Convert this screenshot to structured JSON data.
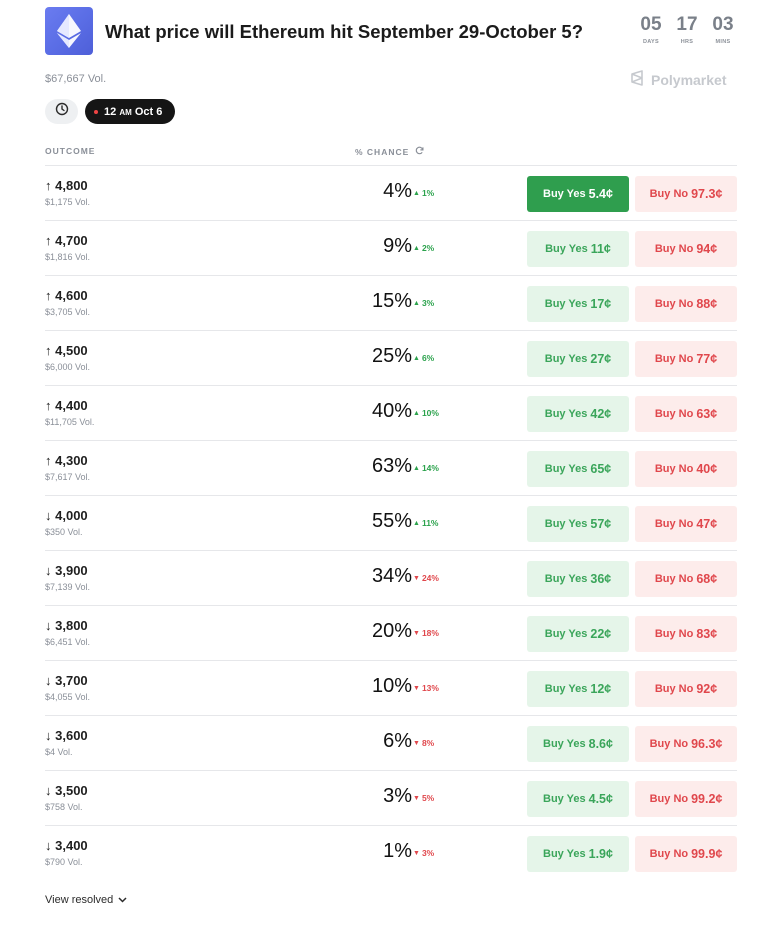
{
  "market": {
    "title": "What price will Ethereum hit September 29-October 5?",
    "volume": "$67,667 Vol.",
    "brand": "Polymarket"
  },
  "countdown": [
    {
      "value": "05",
      "label": "DAYS"
    },
    {
      "value": "17",
      "label": "HRS"
    },
    {
      "value": "03",
      "label": "MINS"
    }
  ],
  "filters": {
    "date_chip_time": "12",
    "date_chip_ampm": "AM",
    "date_chip_date": "Oct 6"
  },
  "columns": {
    "outcome": "OUTCOME",
    "chance": "% CHANCE"
  },
  "rows": [
    {
      "arrow": "↑",
      "label": "4,800",
      "vol": "$1,175 Vol.",
      "chance": "4%",
      "delta": "1%",
      "dir": "up",
      "yes_label": "Buy Yes",
      "yes_price": "5.4¢",
      "no_label": "Buy No",
      "no_price": "97.3¢",
      "selected": true
    },
    {
      "arrow": "↑",
      "label": "4,700",
      "vol": "$1,816 Vol.",
      "chance": "9%",
      "delta": "2%",
      "dir": "up",
      "yes_label": "Buy Yes",
      "yes_price": "11¢",
      "no_label": "Buy No",
      "no_price": "94¢"
    },
    {
      "arrow": "↑",
      "label": "4,600",
      "vol": "$3,705 Vol.",
      "chance": "15%",
      "delta": "3%",
      "dir": "up",
      "yes_label": "Buy Yes",
      "yes_price": "17¢",
      "no_label": "Buy No",
      "no_price": "88¢"
    },
    {
      "arrow": "↑",
      "label": "4,500",
      "vol": "$6,000 Vol.",
      "chance": "25%",
      "delta": "6%",
      "dir": "up",
      "yes_label": "Buy Yes",
      "yes_price": "27¢",
      "no_label": "Buy No",
      "no_price": "77¢"
    },
    {
      "arrow": "↑",
      "label": "4,400",
      "vol": "$11,705 Vol.",
      "chance": "40%",
      "delta": "10%",
      "dir": "up",
      "yes_label": "Buy Yes",
      "yes_price": "42¢",
      "no_label": "Buy No",
      "no_price": "63¢"
    },
    {
      "arrow": "↑",
      "label": "4,300",
      "vol": "$7,617 Vol.",
      "chance": "63%",
      "delta": "14%",
      "dir": "up",
      "yes_label": "Buy Yes",
      "yes_price": "65¢",
      "no_label": "Buy No",
      "no_price": "40¢"
    },
    {
      "arrow": "↓",
      "label": "4,000",
      "vol": "$350 Vol.",
      "chance": "55%",
      "delta": "11%",
      "dir": "up",
      "yes_label": "Buy Yes",
      "yes_price": "57¢",
      "no_label": "Buy No",
      "no_price": "47¢"
    },
    {
      "arrow": "↓",
      "label": "3,900",
      "vol": "$7,139 Vol.",
      "chance": "34%",
      "delta": "24%",
      "dir": "down",
      "yes_label": "Buy Yes",
      "yes_price": "36¢",
      "no_label": "Buy No",
      "no_price": "68¢"
    },
    {
      "arrow": "↓",
      "label": "3,800",
      "vol": "$6,451 Vol.",
      "chance": "20%",
      "delta": "18%",
      "dir": "down",
      "yes_label": "Buy Yes",
      "yes_price": "22¢",
      "no_label": "Buy No",
      "no_price": "83¢"
    },
    {
      "arrow": "↓",
      "label": "3,700",
      "vol": "$4,055 Vol.",
      "chance": "10%",
      "delta": "13%",
      "dir": "down",
      "yes_label": "Buy Yes",
      "yes_price": "12¢",
      "no_label": "Buy No",
      "no_price": "92¢"
    },
    {
      "arrow": "↓",
      "label": "3,600",
      "vol": "$4 Vol.",
      "chance": "6%",
      "delta": "8%",
      "dir": "down",
      "yes_label": "Buy Yes",
      "yes_price": "8.6¢",
      "no_label": "Buy No",
      "no_price": "96.3¢"
    },
    {
      "arrow": "↓",
      "label": "3,500",
      "vol": "$758 Vol.",
      "chance": "3%",
      "delta": "5%",
      "dir": "down",
      "yes_label": "Buy Yes",
      "yes_price": "4.5¢",
      "no_label": "Buy No",
      "no_price": "99.2¢"
    },
    {
      "arrow": "↓",
      "label": "3,400",
      "vol": "$790 Vol.",
      "chance": "1%",
      "delta": "3%",
      "dir": "down",
      "yes_label": "Buy Yes",
      "yes_price": "1.9¢",
      "no_label": "Buy No",
      "no_price": "99.9¢"
    }
  ],
  "footer": {
    "view_resolved": "View resolved"
  },
  "colors": {
    "yes_bg": "#e5f5e9",
    "yes_text": "#3aa55a",
    "yes_selected": "#2f9e4e",
    "no_bg": "#fdeceb",
    "no_text": "#e0474c",
    "up": "#2ba24c",
    "down": "#e0474c"
  },
  "icons": {
    "logo": "ethereum-icon",
    "brand": "polymarket-logo-icon",
    "clock": "clock-icon",
    "refresh": "refresh-icon",
    "chevron": "chevron-down-icon"
  }
}
